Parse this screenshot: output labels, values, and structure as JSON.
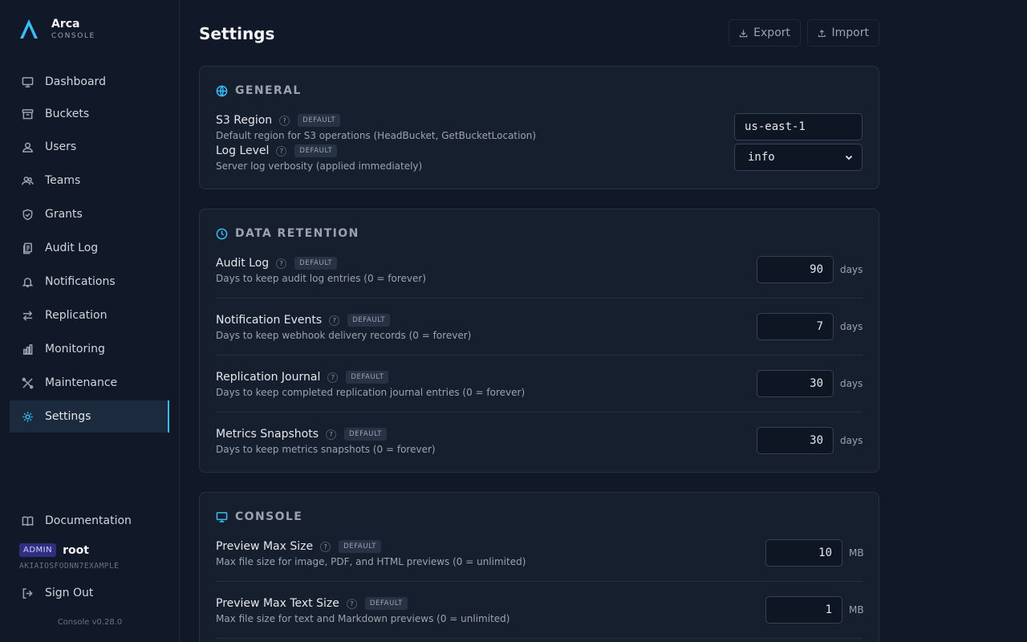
{
  "brand": {
    "name": "Arca",
    "subtitle": "CONSOLE"
  },
  "nav": [
    {
      "label": "Dashboard",
      "icon": "monitor-icon"
    },
    {
      "label": "Buckets",
      "icon": "archive-icon"
    },
    {
      "label": "Users",
      "icon": "user-icon"
    },
    {
      "label": "Teams",
      "icon": "users-icon"
    },
    {
      "label": "Grants",
      "icon": "shield-icon"
    },
    {
      "label": "Audit Log",
      "icon": "clipboard-icon"
    },
    {
      "label": "Notifications",
      "icon": "bell-icon"
    },
    {
      "label": "Replication",
      "icon": "arrows-icon"
    },
    {
      "label": "Monitoring",
      "icon": "bar-chart-icon"
    },
    {
      "label": "Maintenance",
      "icon": "wrench-icon"
    },
    {
      "label": "Settings",
      "icon": "gear-icon",
      "active": true
    }
  ],
  "footer": {
    "docs_label": "Documentation",
    "role_badge": "ADMIN",
    "user_name": "root",
    "access_key": "AKIAIOSFODNN7EXAMPLE",
    "sign_out_label": "Sign Out",
    "version": "Console v0.28.0"
  },
  "header": {
    "title": "Settings",
    "export_label": "Export",
    "import_label": "Import"
  },
  "default_badge": "DEFAULT",
  "help_glyph": "?",
  "sections": {
    "general": {
      "title": "GENERAL",
      "s3_region": {
        "label": "S3 Region",
        "desc": "Default region for S3 operations (HeadBucket, GetBucketLocation)",
        "value": "us-east-1"
      },
      "log_level": {
        "label": "Log Level",
        "desc": "Server log verbosity (applied immediately)",
        "value": "info"
      }
    },
    "retention": {
      "title": "DATA RETENTION",
      "rows": [
        {
          "label": "Audit Log",
          "desc": "Days to keep audit log entries (0 = forever)",
          "value": "90",
          "unit": "days"
        },
        {
          "label": "Notification Events",
          "desc": "Days to keep webhook delivery records (0 = forever)",
          "value": "7",
          "unit": "days"
        },
        {
          "label": "Replication Journal",
          "desc": "Days to keep completed replication journal entries (0 = forever)",
          "value": "30",
          "unit": "days"
        },
        {
          "label": "Metrics Snapshots",
          "desc": "Days to keep metrics snapshots (0 = forever)",
          "value": "30",
          "unit": "days"
        }
      ]
    },
    "console": {
      "title": "CONSOLE",
      "rows": [
        {
          "label": "Preview Max Size",
          "desc": "Max file size for image, PDF, and HTML previews (0 = unlimited)",
          "value": "10",
          "unit": "MB"
        },
        {
          "label": "Preview Max Text Size",
          "desc": "Max file size for text and Markdown previews (0 = unlimited)",
          "value": "1",
          "unit": "MB"
        }
      ]
    }
  },
  "colors": {
    "accent": "#38bdf8",
    "background": "#111827",
    "card": "#161f2e"
  }
}
